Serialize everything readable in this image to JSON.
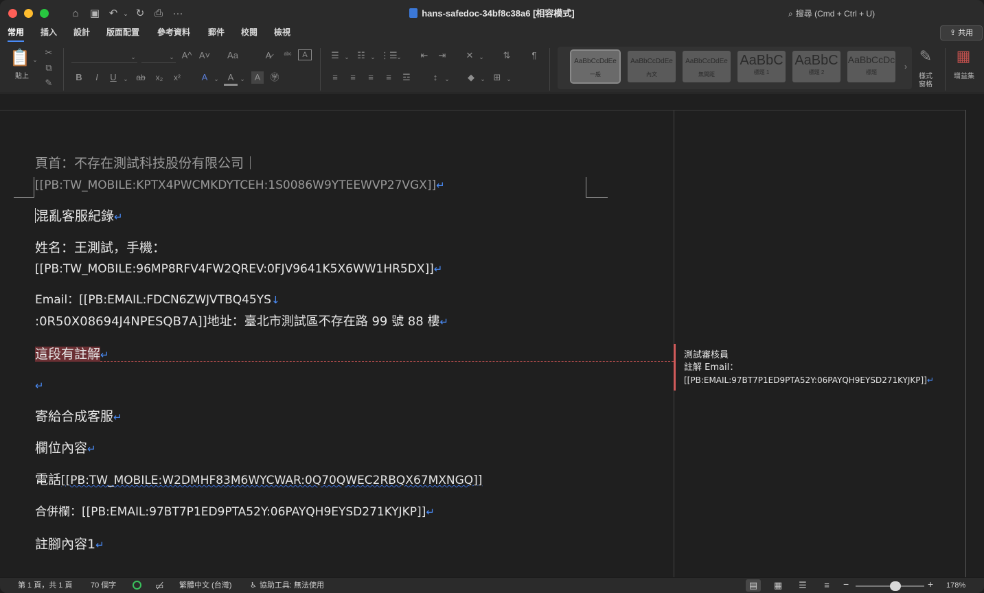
{
  "window": {
    "title": "hans-safedoc-34bf8c38a6 [相容模式]",
    "search_placeholder": "搜尋 (Cmd + Ctrl + U)"
  },
  "quick_access": {
    "home_icon": "⌂",
    "save_icon": "▣",
    "undo_icon": "↶",
    "redo_icon": "↻",
    "print_icon": "⎙",
    "more_icon": "···"
  },
  "tabs": [
    "常用",
    "插入",
    "設計",
    "版面配置",
    "參考資料",
    "郵件",
    "校閱",
    "檢視"
  ],
  "share_label": "共用",
  "ribbon": {
    "paste_label": "貼上",
    "styles_pane_label": "樣式\n窗格",
    "addins_label": "增益集",
    "styles": [
      {
        "sample": "AaBbCcDdEe",
        "name": "一般"
      },
      {
        "sample": "AaBbCcDdEe",
        "name": "內文"
      },
      {
        "sample": "AaBbCcDdEe",
        "name": "無間距"
      },
      {
        "sample": "AaBbC",
        "name": "標題 1"
      },
      {
        "sample": "AaBbC",
        "name": "標題 2"
      },
      {
        "sample": "AaBbCcDc",
        "name": "標題"
      }
    ],
    "font_buttons": {
      "grow": "A^",
      "shrink": "A˅",
      "case": "Aa",
      "clear": "A̷",
      "bold": "B",
      "italic": "I",
      "underline": "U",
      "strike": "ab",
      "sub": "x₂",
      "sup": "x²"
    }
  },
  "document": {
    "header_line1": "頁首：不存在測試科技股份有限公司｜",
    "header_line2": "[[PB:TW_MOBILE:KPTX4PWCMKDYTCEH:1S0086W9YTEEWVP27VGX]]",
    "title": "混亂客服紀錄",
    "name_line1": "姓名：王測試，手機：",
    "name_line2": "[[PB:TW_MOBILE:96MP8RFV4FW2QREV:0FJV9641K5X6WW1HR5DX]]",
    "email_line1": "Email：[[PB:EMAIL:FDCN6ZWJVTBQ45YS",
    "email_line2": ":0R50X08694J4NPESQB7A]]地址：臺北市測試區不存在路 99 號 88 樓",
    "commented_text": "這段有註解",
    "empty_para": "",
    "send_line": "寄給合成客服",
    "field_line": "欄位內容",
    "phone_prefix": "電話",
    "phone_value": "[[PB:TW_MOBILE:W2DMHF83M6WYCWAR:0Q70QWEC2RBQX67MXNGQ]]",
    "merge_line": "合併欄：[[PB:EMAIL:97BT7P1ED9PTA52Y:06PAYQH9EYSD271KYJKP]]",
    "footnote_line": "註腳內容1",
    "para_mark": "↵",
    "line_break_mark": "↓"
  },
  "comment": {
    "author": "測試審核員",
    "line2": "註解 Email：",
    "line3": "[[PB:EMAIL:97BT7P1ED9PTA52Y:06PAYQH9EYSD271KYJKP]]"
  },
  "statusbar": {
    "page": "第 1 頁，共 1 頁",
    "words": "70 個字",
    "language": "繁體中文 (台灣)",
    "accessibility": "協助工具: 無法使用",
    "zoom": "178%",
    "zoom_minus": "−",
    "zoom_plus": "+"
  }
}
